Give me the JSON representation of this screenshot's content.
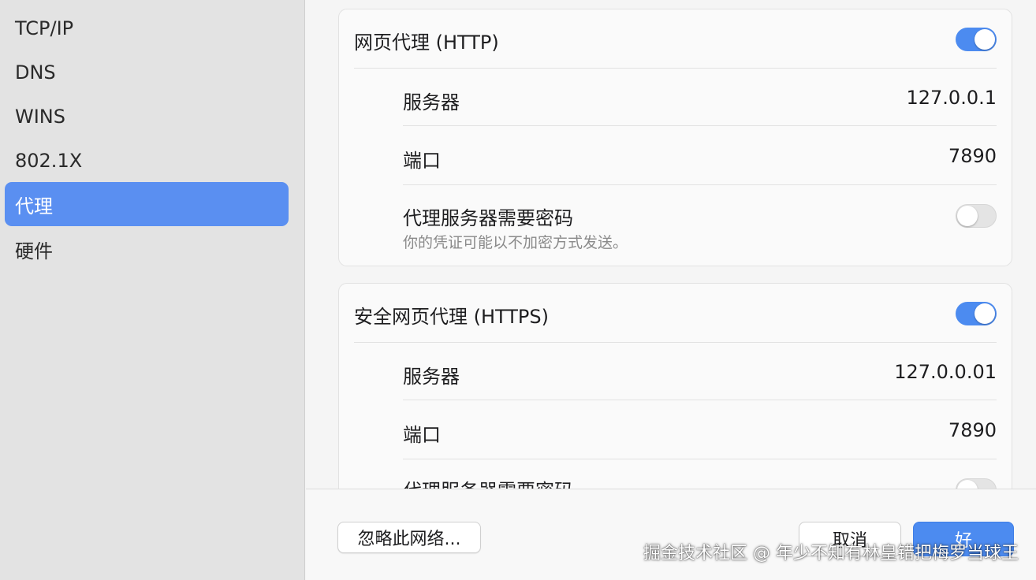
{
  "sidebar": {
    "items": [
      {
        "label": "TCP/IP"
      },
      {
        "label": "DNS"
      },
      {
        "label": "WINS"
      },
      {
        "label": "802.1X"
      },
      {
        "label": "代理",
        "selected": true
      },
      {
        "label": "硬件"
      }
    ]
  },
  "http_proxy": {
    "title": "网页代理 (HTTP)",
    "enabled": true,
    "server_label": "服务器",
    "server_value": "127.0.0.1",
    "port_label": "端口",
    "port_value": "7890",
    "auth_label": "代理服务器需要密码",
    "auth_note": "你的凭证可能以不加密方式发送。",
    "auth_enabled": false
  },
  "https_proxy": {
    "title": "安全网页代理 (HTTPS)",
    "enabled": true,
    "server_label": "服务器",
    "server_value": "127.0.0.01",
    "port_label": "端口",
    "port_value": "7890",
    "auth_label": "代理服务器需要密码",
    "auth_enabled": false
  },
  "footer": {
    "ignore_button": "忽略此网络...",
    "cancel_button": "取消",
    "ok_button": "好"
  },
  "watermark": "掘金技术社区 @ 年少不知有林皇错把梅罗当球王",
  "colors": {
    "accent": "#4c8bf0",
    "sidebar_bg": "#e3e3e3",
    "selected_item": "#5a8ff1"
  }
}
